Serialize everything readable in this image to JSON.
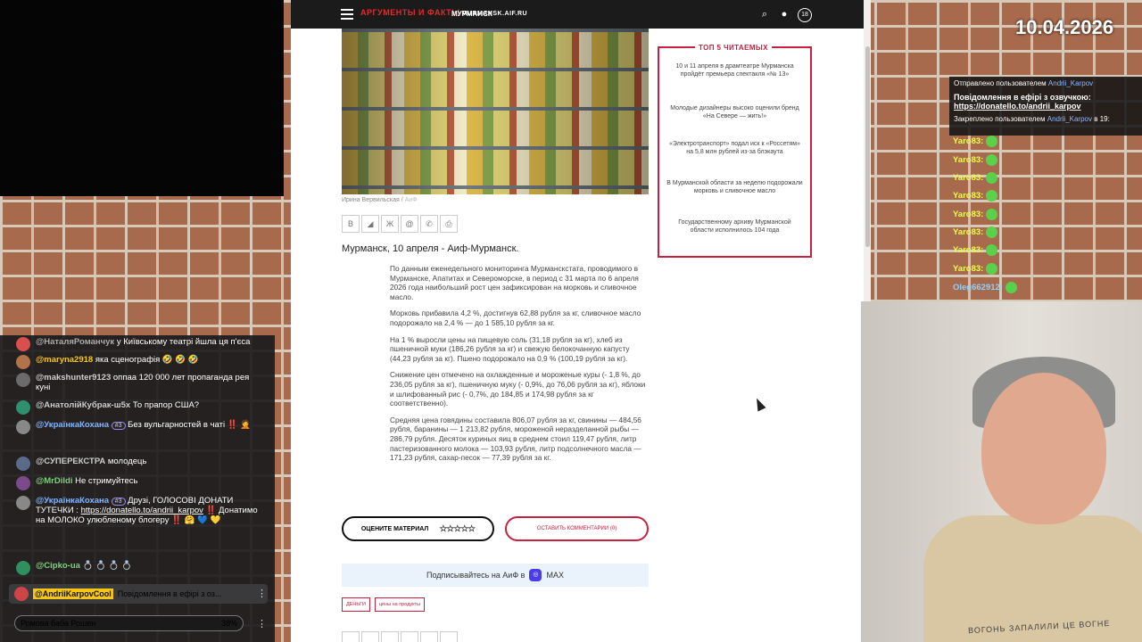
{
  "overlay": {
    "date": "10.04.2026"
  },
  "site": {
    "logo_main": "АРГУМЕНТЫ И ФАКТЫ",
    "logo_domain": "MURMANSK.AIF.RU",
    "city": "МУРМАНСК"
  },
  "article": {
    "photo_credit": "Ирина Вервильская /",
    "photo_credit_src": "АиФ",
    "dateline": "Мурманск, 10 апреля - Аиф-Мурманск.",
    "paragraphs": [
      "По данным еженедельного мониторинга Мурманскстата, проводимого в Мурманске, Апатитах и Североморске, в период с 31 марта по 6 апреля 2026 года наибольший рост цен зафиксирован на морковь и сливочное масло.",
      "Морковь прибавила 4,2 %, достигнув 62,88 рубля за кг, сливочное масло подорожало на 2,4 % — до 1 585,10 рубля за кг.",
      "На 1 % выросли цены на пищевую соль (31,18 рубля за кг), хлеб из пшеничной муки (186,26 рубля за кг) и свежую белокочанную капусту (44,23 рубля за кг). Пшено подорожало на 0,9 % (100,19 рубля за кг).",
      "Снижение цен отмечено на охлажденные и мороженые куры (- 1,8 %, до 236,05 рубля за кг), пшеничную муку (- 0,9%, до 76,06 рубля за кг), яблоки и шлифованный рис (- 0,7%, до 184,85 и 174,98 рубля за кг соответственно).",
      "Средняя цена говядины составила 806,07 рубля за кг, свинины — 484,56 рубля, баранины — 1 213,82 рубля, мороженой неразделанной рыбы — 286,79 рубля. Десяток куриных яиц в среднем стоил 119,47 рубля, литр пастеризованного молока — 103,93 рубля, литр подсолнечного масла — 171,23 рубля, сахар-песок — 77,39 рубля за кг."
    ],
    "rate_label": "ОЦЕНИТЕ МАТЕРИАЛ",
    "stars": "☆☆☆☆☆",
    "comment_label": "ОСТАВИТЬ КОММЕНТАРИИ (0)",
    "subscribe_label": "Подписывайтесь на АиФ в",
    "subscribe_service": "MAX",
    "tags": [
      "ДЕНЬГИ",
      "цены на продукты"
    ],
    "share_icons": [
      "В",
      "◢",
      "Ж",
      "@",
      "✆",
      "⎙"
    ]
  },
  "top5": {
    "title": "ТОП 5 ЧИТАЕМЫХ",
    "items": [
      "10 и 11 апреля в драмтеатре Мурманска пройдёт премьера спектакля «№ 13»",
      "Молодые дизайнеры высоко оценили бренд «На Севере — жить!»",
      "«Электротранспорт» подал иск к «Россетям» на 5,8 млн рублей из-за блэкаута",
      "В Мурманской области за неделю подорожали морковь и сливочное масло",
      "Государственному архиву Мурманской области исполнилось 104 года"
    ]
  },
  "left_chat": {
    "messages": [
      {
        "nick": "@НаталяРоманчук",
        "text": "у Київському театрі йшла ця п'єса",
        "color": "#d94f4f"
      },
      {
        "nick": "@maryna2918",
        "text": "яка сценографія 🤣 🤣 🤣",
        "color": "#b3734a"
      },
      {
        "nick": "@makshunter9123",
        "text": "оппаа 120 000 лет пропаганда рея куні",
        "color": "#6b6b6b"
      },
      {
        "nick": "@АнатолійКубрак-ш5х",
        "text": "То прапор США?",
        "color": "#2f8f6f"
      },
      {
        "nick": "@УкраїнкаКохана",
        "badge": "#3",
        "text": "Без вульгарностей в чаті ‼️ 🤦",
        "color": "#888"
      },
      {
        "nick": "@СУПЕРЕКСТРА",
        "text": "молодець",
        "color": "#5a6a8a"
      },
      {
        "nick": "@MrDildi",
        "text": "Не стримуйтесь",
        "color": "#7a4a8a"
      },
      {
        "nick": "@УкраїнкаКохана",
        "badge": "#3",
        "text": "Друзі, ГОЛОСОВІ ДОНАТИ ТУТЕЧКИ :",
        "link": "https://donatello.to/andrii_karpov",
        "text2": "‼️ Донатимо на МОЛОКО улюбленому блогеру ‼️ 🤗 💙 💛",
        "color": "#888"
      },
      {
        "nick": "@Cipko-ua",
        "text": "💍 💍 💍 💍",
        "color": "#2f8f5f"
      }
    ],
    "pinned_nick": "@AndriiKarpovCool",
    "pinned_text": "Повідомлення в ефірі з оз...",
    "poll_label": "Ромова баба Рошен",
    "poll_percent": "38%"
  },
  "right_chat": {
    "sent_by": "Отправлено пользователем",
    "sender": "Andrii_Karpov",
    "message": "Повідомлення в ефірі з озвучкою:",
    "link": "https://donatello.to/andrii_karpov",
    "pinned_by": "Закреплено пользователем",
    "pinned_user": "Andrii_Karpov",
    "pinned_suffix": "в 19:",
    "messages": [
      "Yaro83:",
      "Yaro83:",
      "Yaro83:",
      "Yaro83:",
      "Yaro83:",
      "Yaro83:",
      "Yaro83:",
      "Yaro83:",
      "Oleg662912:"
    ]
  },
  "cam": {
    "shirt_text": "ВОГОНЬ ЗАПАЛИЛИ ЦЕ ВОГНЕ"
  }
}
